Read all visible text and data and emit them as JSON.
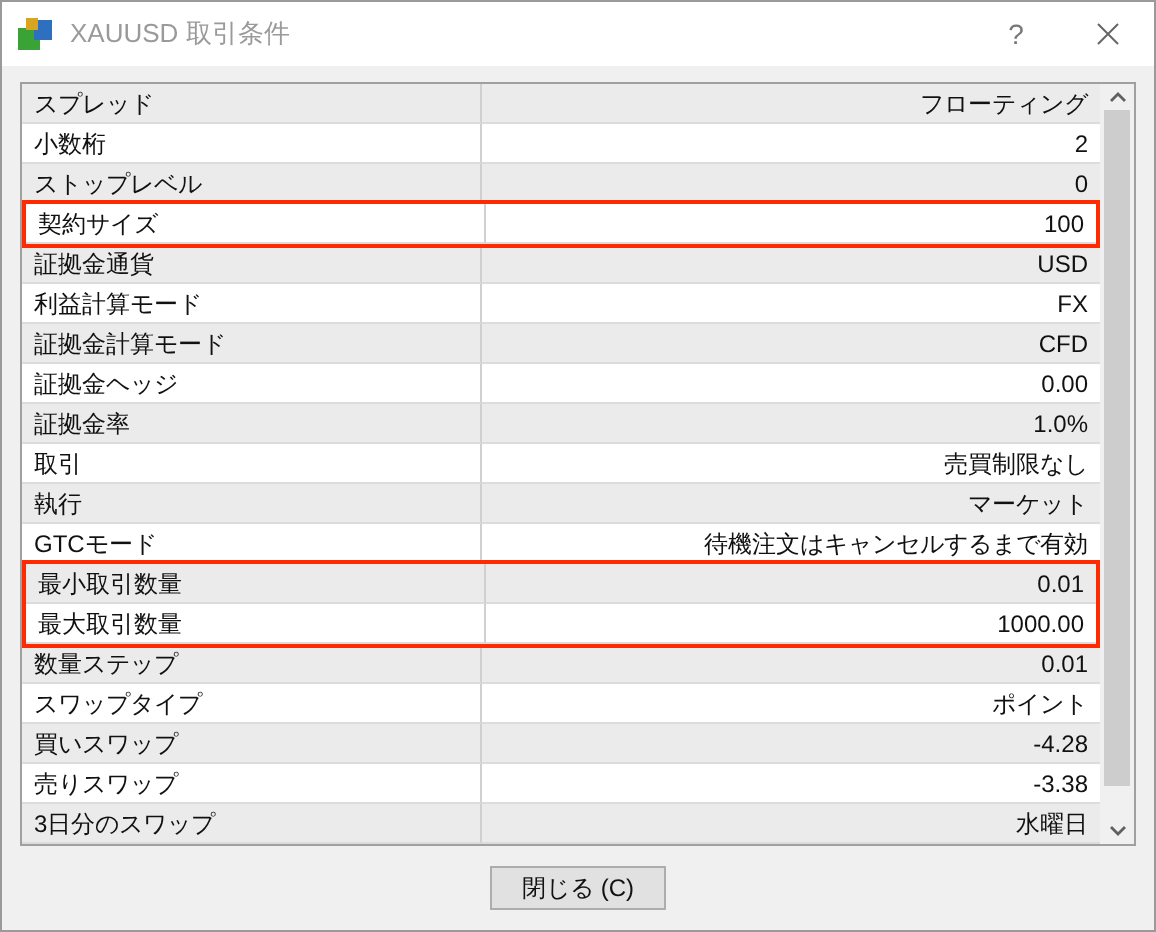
{
  "window": {
    "title": "XAUUSD 取引条件",
    "help": "?"
  },
  "rows": [
    {
      "label": "スプレッド",
      "value": "フローティング",
      "highlighted": false
    },
    {
      "label": "小数桁",
      "value": "2",
      "highlighted": false
    },
    {
      "label": "ストップレベル",
      "value": "0",
      "highlighted": false
    },
    {
      "label": "契約サイズ",
      "value": "100",
      "highlighted": true
    },
    {
      "label": "証拠金通貨",
      "value": "USD",
      "highlighted": false
    },
    {
      "label": "利益計算モード",
      "value": "FX",
      "highlighted": false
    },
    {
      "label": "証拠金計算モード",
      "value": "CFD",
      "highlighted": false
    },
    {
      "label": "証拠金ヘッジ",
      "value": "0.00",
      "highlighted": false
    },
    {
      "label": "証拠金率",
      "value": "1.0%",
      "highlighted": false
    },
    {
      "label": "取引",
      "value": "売買制限なし",
      "highlighted": false
    },
    {
      "label": "執行",
      "value": "マーケット",
      "highlighted": false
    },
    {
      "label": "GTCモード",
      "value": "待機注文はキャンセルするまで有効",
      "highlighted": false
    },
    {
      "label": "最小取引数量",
      "value": "0.01",
      "highlighted": true
    },
    {
      "label": "最大取引数量",
      "value": "1000.00",
      "highlighted": true
    },
    {
      "label": "数量ステップ",
      "value": "0.01",
      "highlighted": false
    },
    {
      "label": "スワップタイプ",
      "value": "ポイント",
      "highlighted": false
    },
    {
      "label": "買いスワップ",
      "value": "-4.28",
      "highlighted": false
    },
    {
      "label": "売りスワップ",
      "value": "-3.38",
      "highlighted": false
    },
    {
      "label": "3日分のスワップ",
      "value": "水曜日",
      "highlighted": false
    }
  ],
  "close_button": "閉じる (C)"
}
